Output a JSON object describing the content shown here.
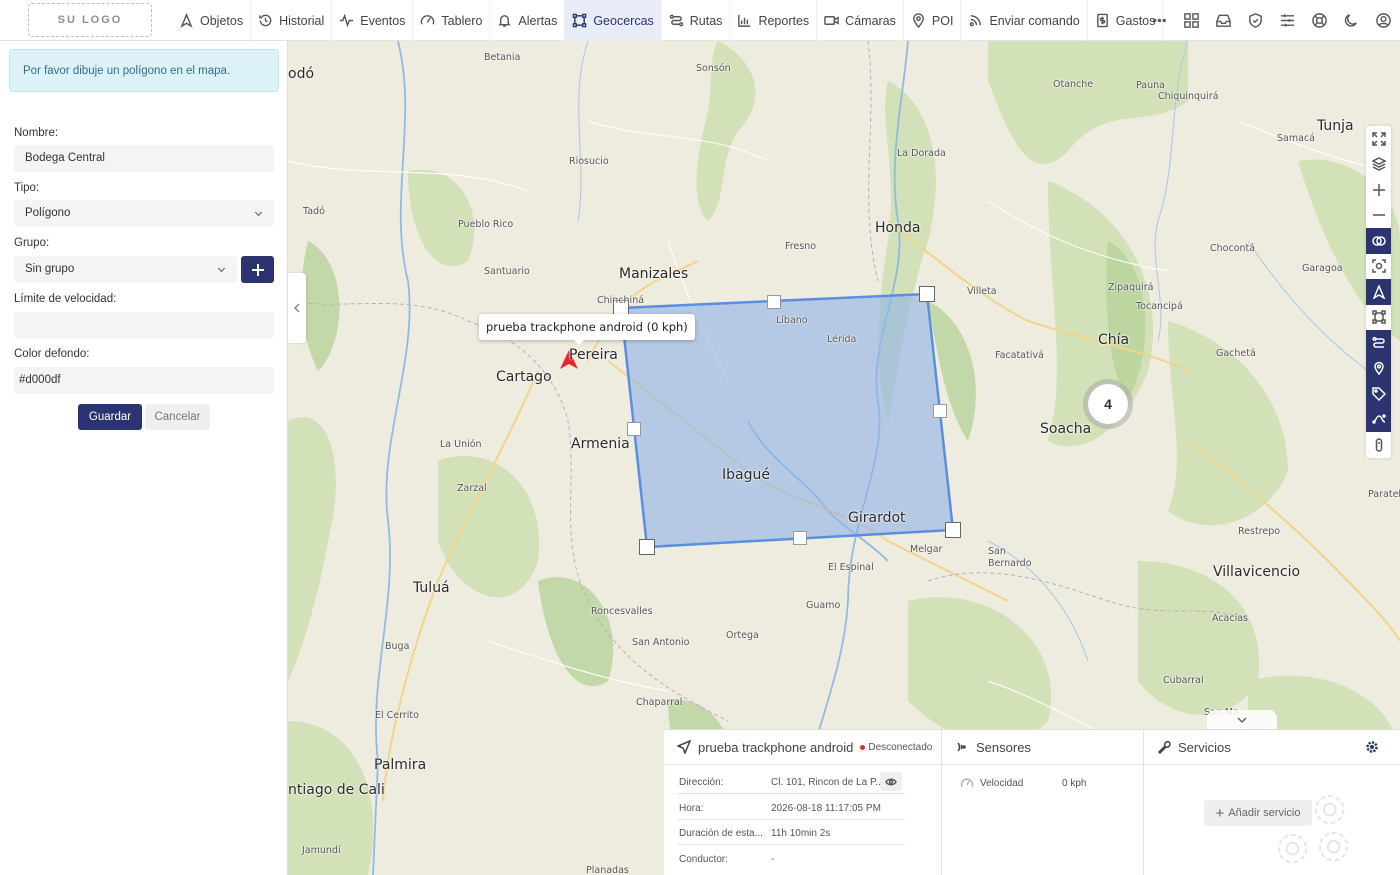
{
  "logo": {
    "text": "SU LOGO"
  },
  "nav": {
    "items": [
      {
        "label": "Objetos",
        "icon": "navigation-icon",
        "active": false
      },
      {
        "label": "Historial",
        "icon": "history-icon",
        "active": false
      },
      {
        "label": "Eventos",
        "icon": "activity-icon",
        "active": false
      },
      {
        "label": "Tablero",
        "icon": "gauge-icon",
        "active": false
      },
      {
        "label": "Alertas",
        "icon": "bell-icon",
        "active": false
      },
      {
        "label": "Geocercas",
        "icon": "geofence-icon",
        "active": true
      },
      {
        "label": "Rutas",
        "icon": "route-icon",
        "active": false
      },
      {
        "label": "Reportes",
        "icon": "bar-chart-icon",
        "active": false
      },
      {
        "label": "Cámaras",
        "icon": "video-icon",
        "active": false
      },
      {
        "label": "POI",
        "icon": "map-pin-icon",
        "active": false
      },
      {
        "label": "Enviar comando",
        "icon": "broadcast-icon",
        "active": false
      },
      {
        "label": "Gastos",
        "icon": "receipt-dollar-icon",
        "active": false
      }
    ],
    "right_icons": [
      "more-icon",
      "grid-icon",
      "inbox-icon",
      "shield-icon",
      "sliders-icon",
      "support-icon",
      "moon-icon",
      "user-icon"
    ]
  },
  "form": {
    "alert": "Por favor dibuje un polígono en el mapa.",
    "name_label": "Nombre:",
    "name_value": "Bodega Central",
    "type_label": "Tipo:",
    "type_value": "Polígono",
    "group_label": "Grupo:",
    "group_value": "Sin grupo",
    "speed_label": "Límite de velocidad:",
    "speed_value": "",
    "color_label": "Color defondo:",
    "color_value": "#d000df",
    "save_label": "Guardar",
    "cancel_label": "Cancelar"
  },
  "map": {
    "tooltip": "prueba trackphone android (0 kph)",
    "cluster_count": "4",
    "cities_large": [
      "Manizales",
      "Pereira",
      "Cartago",
      "Armenia",
      "Ibagué",
      "Girardot",
      "Honda",
      "Chía",
      "Soacha",
      "Tunja",
      "Villavicencio",
      "Tuluá",
      "Palmira",
      "ntiago de Cali",
      "odó"
    ],
    "cities_small": [
      "Betania",
      "Sonsón",
      "Otanche",
      "Pauna",
      "Chiquinquirá",
      "Samacá",
      "Riosucio",
      "La Dorada",
      "Tadó",
      "Pueblo Rico",
      "Fresno",
      "Chocontá",
      "Santuario",
      "Garagoa",
      "Zipaquirá",
      "Tocancipá",
      "Chinchiná",
      "Líbano",
      "Villeta",
      "Lérida",
      "Facatativá",
      "Gachetá",
      "La Unión",
      "Zarzal",
      "Paratebue",
      "Restrepo",
      "Melgar",
      "San Bernardo",
      "El Espinal",
      "Guamo",
      "Roncesvalles",
      "Ortega",
      "San Antonio",
      "Acacías",
      "Buga",
      "Chaparral",
      "Cubarral",
      "El Cerrito",
      "Jamundí",
      "Planadas",
      "San Ma"
    ],
    "tools": [
      {
        "icon": "fullscreen-icon",
        "on": false
      },
      {
        "icon": "layers-icon",
        "on": false
      },
      {
        "icon": "zoom-in-icon",
        "on": false
      },
      {
        "icon": "zoom-out-icon",
        "on": false
      },
      {
        "icon": "geofences-layer-icon",
        "on": true
      },
      {
        "icon": "focus-icon",
        "on": false
      },
      {
        "icon": "objects-layer-icon",
        "on": true
      },
      {
        "icon": "polygon-icon",
        "on": false
      },
      {
        "icon": "routes-layer-icon",
        "on": true
      },
      {
        "icon": "poi-layer-icon",
        "on": true
      },
      {
        "icon": "tags-icon",
        "on": true
      },
      {
        "icon": "history-layer-icon",
        "on": true
      },
      {
        "icon": "device-icon",
        "on": false
      }
    ],
    "colors": {
      "geofence_fill": "#8fb3e8",
      "geofence_stroke": "#5a8fe0",
      "marker": "#e8232a"
    }
  },
  "info": {
    "device_name": "prueba trackphone android",
    "status": "Desconectado",
    "rows": [
      {
        "k": "Dirección:",
        "v": "Cl. 101, Rincon de La P..."
      },
      {
        "k": "Hora:",
        "v": "2026-08-18 11:17:05 PM"
      },
      {
        "k": "Duración de esta...",
        "v": "11h 10min 2s"
      },
      {
        "k": "Conductor:",
        "v": "-"
      }
    ],
    "sensors_title": "Sensores",
    "sensor_name": "Velocidad",
    "sensor_value": "0 kph",
    "services_title": "Servicios",
    "add_service": "Añadir servicio"
  }
}
